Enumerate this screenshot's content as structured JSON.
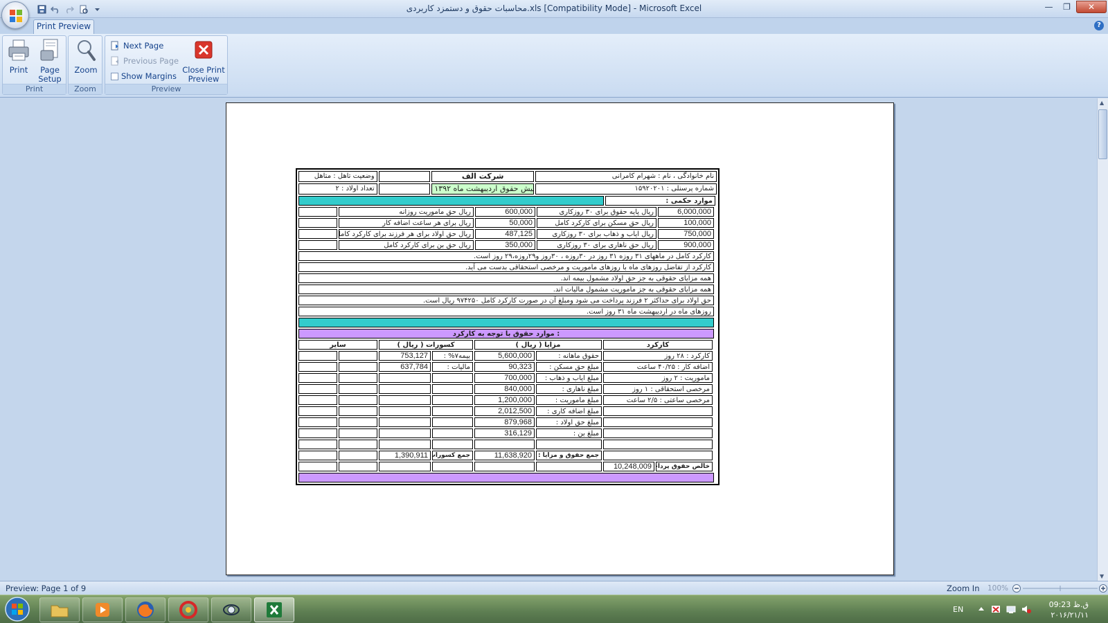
{
  "window": {
    "title": "محاسبات حقوق و دستمزد کاربردی.xls  [Compatibility Mode] - Microsoft Excel",
    "minimize": "—",
    "maximize": "❐",
    "close": "✕"
  },
  "ribbon": {
    "active_tab": "Print Preview",
    "help": "?",
    "groups": {
      "print": {
        "label": "Print",
        "print_button": "Print",
        "page_setup_line1": "Page",
        "page_setup_line2": "Setup"
      },
      "zoom": {
        "label": "Zoom",
        "zoom_button": "Zoom"
      },
      "preview": {
        "label": "Preview",
        "next_page": "Next Page",
        "previous_page": "Previous Page",
        "show_margins": "Show Margins",
        "close_line1": "Close Print",
        "close_line2": "Preview"
      }
    }
  },
  "payslip": {
    "header": {
      "marital": "وضعیت تاهل : متاهل",
      "company": "شرکت الف",
      "employee_name": "نام خانوادگی ، نام : شهرام کامرانی",
      "children": "تعداد اولاد : ۲",
      "slip_title": "فیش حقوق اردیبهشت ماه ۱۳۹۲",
      "personnel_no": "شماره پرسنلی : ۱۵۹۲۰۲۰۱"
    },
    "legal_heading": "موارد حکمی :",
    "legal_items": [
      {
        "left_label": "ریال حق ماموریت روزانه",
        "left_value": "600,000",
        "right_label": "ریال پایه حقوق برای ۳۰ روزکاری",
        "right_value": "6,000,000"
      },
      {
        "left_label": "ریال برای هر ساعت اضافه کار",
        "left_value": "50,000",
        "right_label": "ریال حق مسکن برای کارکرد کامل",
        "right_value": "100,000"
      },
      {
        "left_label": "ریال حق اولاد برای هر فرزند برای کارکرد کامل",
        "left_value": "487,125",
        "right_label": "ریال ایاب و ذهاب برای ۳۰ روزکاری",
        "right_value": "750,000"
      },
      {
        "left_label": "ریال حق بن برای کارکرد کامل",
        "left_value": "350,000",
        "right_label": "ریال حق ناهاری برای ۳۰ روزکاری",
        "right_value": "900,000"
      }
    ],
    "notes": [
      "کارکرد کامل در ماههای ۳۱ روزه ۳۱ روز در ۳۰روزه ، ۳۰روز و۲۹روزه،۲۹ روز است.",
      "کارکرد از تفاضل روزهای ماه با روزهای ماموریت و مرخصی استحقاقی بدست می آید.",
      "همه مزایای حقوقی به جز حق اولاد مشمول بیمه اند.",
      "همه مزایای حقوقی به جز ماموریت مشمول مالیات اند.",
      "حق اولاد برای حداکثر ۲ فرزند پرداخت می شود ومبلغ آن در صورت کارکرد کامل ۹۷۴۲۵۰ ریال است.",
      "روزهای ماه در اردیبهشت ماه ۳۱ روز است."
    ],
    "calc_heading": "موارد حقوق با توجه به کارکرد :",
    "col_headers": {
      "other": "سایر",
      "deductions": "کسورات ( ریال )",
      "benefits": "مزایا ( ریال )",
      "attendance": "کارکرد"
    },
    "calc_rows": [
      {
        "ded_label": "بیمه۷%  :",
        "ded_value": "753,127",
        "ben_label": "حقوق ماهانه :",
        "ben_value": "5,600,000",
        "attendance": "کارکرد : ۲۸ روز"
      },
      {
        "ded_label": "مالیات  :",
        "ded_value": "637,784",
        "ben_label": "مبلغ حق مسکن  :",
        "ben_value": "90,323",
        "attendance": "اضافه کار : ۴۰/۲۵ ساعت"
      },
      {
        "ded_label": "",
        "ded_value": "",
        "ben_label": "مبلغ ایاب و ذهاب  :",
        "ben_value": "700,000",
        "attendance": "ماموریت : ۲ روز"
      },
      {
        "ded_label": "",
        "ded_value": "",
        "ben_label": "مبلغ ناهاری  :",
        "ben_value": "840,000",
        "attendance": "مرخصی استحقاقی : ۱ روز"
      },
      {
        "ded_label": "",
        "ded_value": "",
        "ben_label": "مبلغ ماموریت  :",
        "ben_value": "1,200,000",
        "attendance": "مرخصی ساعتی : ۲/۵ ساعت"
      },
      {
        "ded_label": "",
        "ded_value": "",
        "ben_label": "مبلغ اضافه کاری  :",
        "ben_value": "2,012,500",
        "attendance": ""
      },
      {
        "ded_label": "",
        "ded_value": "",
        "ben_label": "مبلغ حق اولاد  :",
        "ben_value": "879,968",
        "attendance": ""
      },
      {
        "ded_label": "",
        "ded_value": "",
        "ben_label": "مبلغ بن  :",
        "ben_value": "316,129",
        "attendance": ""
      },
      {
        "ded_label": "",
        "ded_value": "",
        "ben_label": "",
        "ben_value": "",
        "attendance": ""
      }
    ],
    "totals": {
      "ded_label": "جمع کسورات  :",
      "ded_value": "1,390,911",
      "ben_label": "جمع حقوق و مزایا  :",
      "ben_value": "11,638,920"
    },
    "net": {
      "label": "خالص حقوق پرداختی  :",
      "value": "10,248,009"
    }
  },
  "statusbar": {
    "preview_status": "Preview: Page 1 of 9",
    "zoom_in": "Zoom In",
    "zoom_percent": "100%"
  },
  "taskbar": {
    "language": "EN",
    "clock_time": "09:23 ق.ظ",
    "clock_date": "۲۰۱۶/۲۱/۱۱"
  },
  "colors": {
    "teal_band": "#33cccc",
    "violet_band": "#cc99ff",
    "slip_title_fill": "#ccffcc",
    "close_preview_red": "#d9362b",
    "excel_green": "#1f7a3a"
  }
}
